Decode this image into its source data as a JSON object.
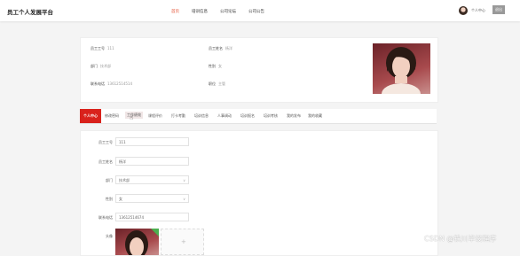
{
  "header": {
    "brand": "员工个人发展平台",
    "nav": [
      "首页",
      "培训信息",
      "公司论坛",
      "公司公告"
    ],
    "active_nav": 0,
    "user_center": "个人中心",
    "logout": "退出"
  },
  "profile": {
    "fields": [
      {
        "label": "员工工号",
        "value": "111"
      },
      {
        "label": "员工姓名",
        "value": "杨洋"
      },
      {
        "label": "部门",
        "value": "技术部"
      },
      {
        "label": "性别",
        "value": "女"
      },
      {
        "label": "联系电话",
        "value": "13612514514"
      },
      {
        "label": "职位",
        "value": "主管"
      }
    ]
  },
  "tabs": [
    "个人中心",
    "修改密码",
    "工作绩效",
    "课程评价",
    "打卡考勤",
    "培训信息",
    "人事调动",
    "培训报名",
    "培训考核",
    "我的发布",
    "我的收藏"
  ],
  "form": {
    "fields": [
      {
        "label": "员工工号",
        "value": "111",
        "type": "input"
      },
      {
        "label": "员工姓名",
        "value": "杨洋",
        "type": "input"
      },
      {
        "label": "部门",
        "value": "技术部",
        "type": "select"
      },
      {
        "label": "性别",
        "value": "女",
        "type": "select"
      },
      {
        "label": "联系电话",
        "value": "13612514674",
        "type": "input"
      }
    ],
    "avatar_label": "头像",
    "upload_plus": "+"
  },
  "watermark": "CSDN @铁川毕设程序",
  "colors": {
    "accent": "#d9221c",
    "active_nav": "#e24a2b"
  }
}
